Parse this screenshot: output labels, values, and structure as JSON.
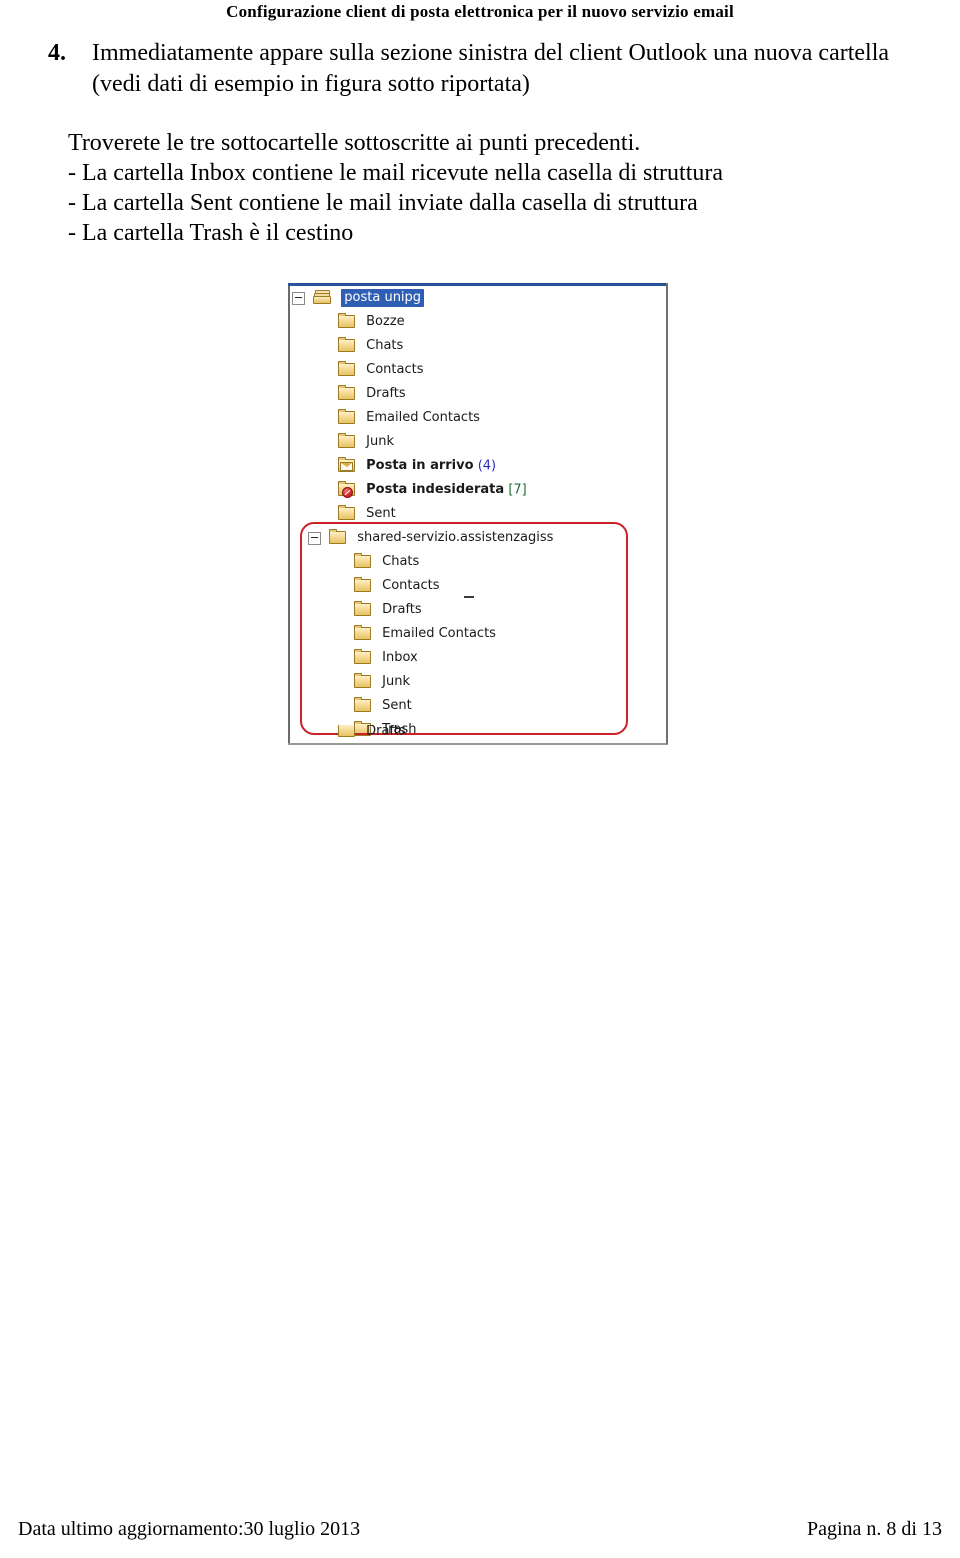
{
  "header": {
    "title": "Configurazione client di posta elettronica per il nuovo servizio email"
  },
  "body": {
    "item_number": "4.",
    "item_line1": "Immediatamente appare sulla sezione sinistra del client Outlook una nuova cartella",
    "item_line2": "(vedi dati di esempio in figura sotto riportata)",
    "paragraph_1": "Troverete le tre sottocartelle sottoscritte ai punti precedenti.",
    "bullet_1": "- La cartella Inbox contiene le mail ricevute nella casella di struttura",
    "bullet_2": "- La cartella Sent contiene le mail inviate dalla casella di struttura",
    "bullet_3": "- La cartella Trash è il cestino"
  },
  "figure": {
    "name": "outlook-folder-tree-screenshot",
    "root": {
      "label": "posta unipg",
      "selected": true,
      "icon": "folder-stack-icon",
      "expanded": true
    },
    "children": [
      {
        "label": "Bozze",
        "icon": "folder-icon"
      },
      {
        "label": "Chats",
        "icon": "folder-icon"
      },
      {
        "label": "Contacts",
        "icon": "folder-icon"
      },
      {
        "label": "Drafts",
        "icon": "folder-icon"
      },
      {
        "label": "Emailed Contacts",
        "icon": "folder-icon"
      },
      {
        "label": "Junk",
        "icon": "folder-icon"
      },
      {
        "label": "Posta in arrivo",
        "count": "(4)",
        "count_style": "new",
        "bold": true,
        "icon": "folder-inbox-icon"
      },
      {
        "label": "Posta indesiderata",
        "count": "[7]",
        "count_style": "junk",
        "bold": true,
        "icon": "folder-junk-icon"
      },
      {
        "label": "Sent",
        "icon": "folder-icon"
      }
    ],
    "shared": {
      "label": "shared-servizio.assistenzagiss",
      "icon": "folder-icon",
      "expanded": true,
      "highlighted": true,
      "children": [
        {
          "label": "Chats",
          "icon": "folder-icon"
        },
        {
          "label": "Contacts",
          "icon": "folder-icon"
        },
        {
          "label": "Drafts",
          "icon": "folder-icon"
        },
        {
          "label": "Emailed Contacts",
          "icon": "folder-icon"
        },
        {
          "label": "Inbox",
          "icon": "folder-icon"
        },
        {
          "label": "Junk",
          "icon": "folder-icon"
        },
        {
          "label": "Sent",
          "icon": "folder-icon"
        },
        {
          "label": "Trash",
          "icon": "folder-icon"
        }
      ]
    },
    "clipped_row": {
      "label": "Drafts",
      "icon": "folder-icon"
    },
    "annotation_color": "#cc2127",
    "selection_color": "#2f5fb4"
  },
  "footer": {
    "left": "Data ultimo aggiornamento:30 luglio 2013",
    "right": "Pagina n. 8 di 13"
  }
}
